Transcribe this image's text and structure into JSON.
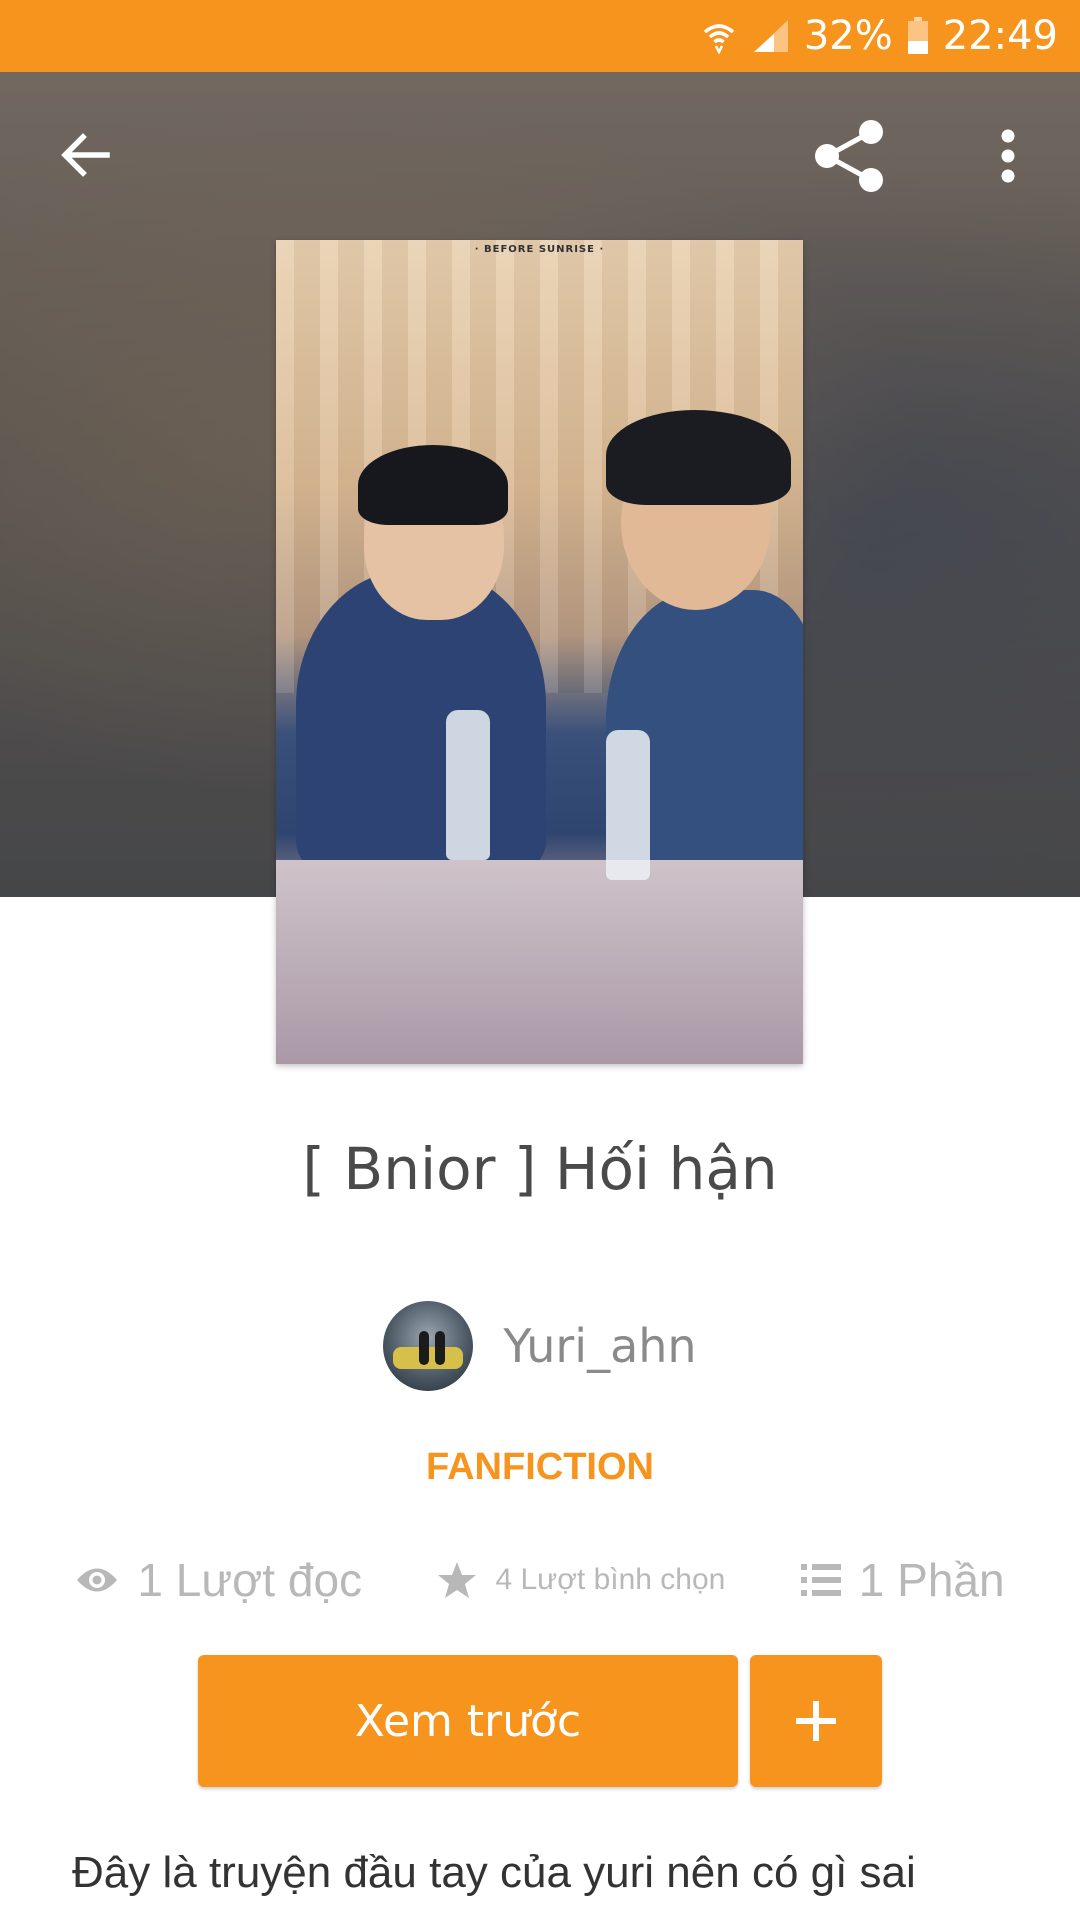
{
  "status_bar": {
    "battery_percent": "32%",
    "time": "22:49",
    "icons": [
      "wifi-icon",
      "signal-icon",
      "battery-icon"
    ]
  },
  "toolbar": {
    "icons": [
      "back-arrow-icon",
      "share-icon",
      "more-vert-icon"
    ]
  },
  "cover": {
    "caption": "· BEFORE SUNRISE ·"
  },
  "story": {
    "title": "[ Bnior ] Hối hận",
    "author": "Yuri_ahn",
    "category": "FANFICTION"
  },
  "stats": {
    "reads": "1 Lượt đọc",
    "votes": "4 Lượt bình chọn",
    "parts": "1 Phần",
    "icons": [
      "eye-icon",
      "star-icon",
      "list-icon"
    ]
  },
  "actions": {
    "preview_label": "Xem trước",
    "add_label": "+"
  },
  "description": "Đây là truyện đầu tay của yuri nên có gì sai",
  "colors": {
    "accent": "#f7941d",
    "stats_text": "#b8b8b8",
    "title_text": "#4a4a4a"
  }
}
